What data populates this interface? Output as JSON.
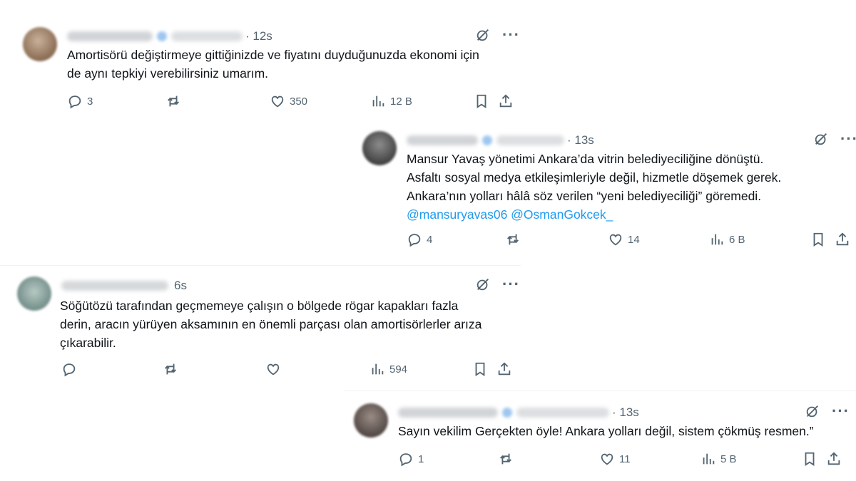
{
  "tweets": [
    {
      "time": "· 12s",
      "lines": [
        "Amortisörü değiştirmeye gittiğinizde ve fiyatını duyduğunuzda ekonomi için",
        "de aynı tepkiyi verebilirsiniz umarım."
      ],
      "mentions": "",
      "replies": "3",
      "retweets": "",
      "likes": "350",
      "views": "12 B"
    },
    {
      "time": "· 13s",
      "lines": [
        "Mansur Yavaş yönetimi Ankara’da vitrin belediyeciliğine dönüştü.",
        "Asfaltı sosyal medya etkileşimleriyle değil, hizmetle döşemek gerek.",
        "Ankara’nın yolları hâlâ söz verilen “yeni belediyeciliği” göremedi."
      ],
      "mentions": "@mansuryavas06 @OsmanGokcek_",
      "replies": "4",
      "retweets": "",
      "likes": "14",
      "views": "6 B"
    },
    {
      "time": "6s",
      "lines": [
        "Söğütözü tarafından geçmemeye çalışın o bölgede rögar kapakları fazla",
        "derin, aracın yürüyen aksamının en önemli parçası olan amortisörlerler arıza",
        "çıkarabilir."
      ],
      "mentions": "",
      "replies": "",
      "retweets": "",
      "likes": "",
      "views": "594"
    },
    {
      "time": "· 13s",
      "lines": [
        "Sayın vekilim Gerçekten öyle! Ankara yolları değil, sistem çökmüş resmen.”"
      ],
      "mentions": "",
      "replies": "1",
      "retweets": "",
      "likes": "11",
      "views": "5 B"
    }
  ],
  "icons": {
    "reply": "reply-icon",
    "retweet": "retweet-icon",
    "like": "heart-icon",
    "views": "views-icon",
    "bookmark": "bookmark-icon",
    "share": "share-icon",
    "grok": "grok-icon",
    "more": "more-icon"
  },
  "colors": {
    "text": "#0f1419",
    "secondary": "#536471",
    "link": "#1d9bf0"
  }
}
